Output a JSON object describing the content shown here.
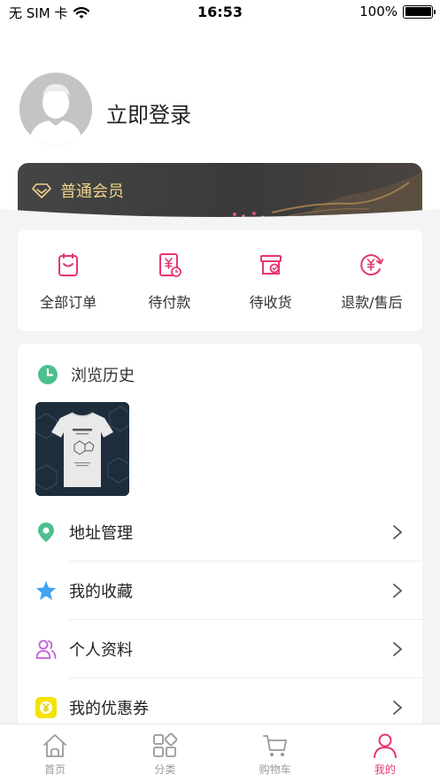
{
  "status_bar": {
    "carrier": "无 SIM 卡",
    "time": "16:53",
    "battery": "100%"
  },
  "profile": {
    "login_label": "立即登录",
    "member_level": "普通会员"
  },
  "orders": [
    {
      "label": "全部订单",
      "icon": "clipboard-icon"
    },
    {
      "label": "待付款",
      "icon": "payment-icon"
    },
    {
      "label": "待收货",
      "icon": "delivery-box-icon"
    },
    {
      "label": "退款/售后",
      "icon": "refund-icon"
    }
  ],
  "history": {
    "title": "浏览历史"
  },
  "menu": [
    {
      "label": "地址管理",
      "icon": "location-pin-icon"
    },
    {
      "label": "我的收藏",
      "icon": "star-icon"
    },
    {
      "label": "个人资料",
      "icon": "user-profile-icon"
    },
    {
      "label": "我的优惠券",
      "icon": "coupon-icon"
    }
  ],
  "tabs": [
    {
      "label": "首页",
      "icon": "home-icon",
      "active": false
    },
    {
      "label": "分类",
      "icon": "category-icon",
      "active": false
    },
    {
      "label": "购物车",
      "icon": "cart-icon",
      "active": false
    },
    {
      "label": "我的",
      "icon": "profile-icon",
      "active": true
    }
  ],
  "colors": {
    "accent": "#e6366b",
    "gold": "#f0d38a",
    "card_dark": "#3f3f3f",
    "page_bg": "#f4f4f4"
  }
}
